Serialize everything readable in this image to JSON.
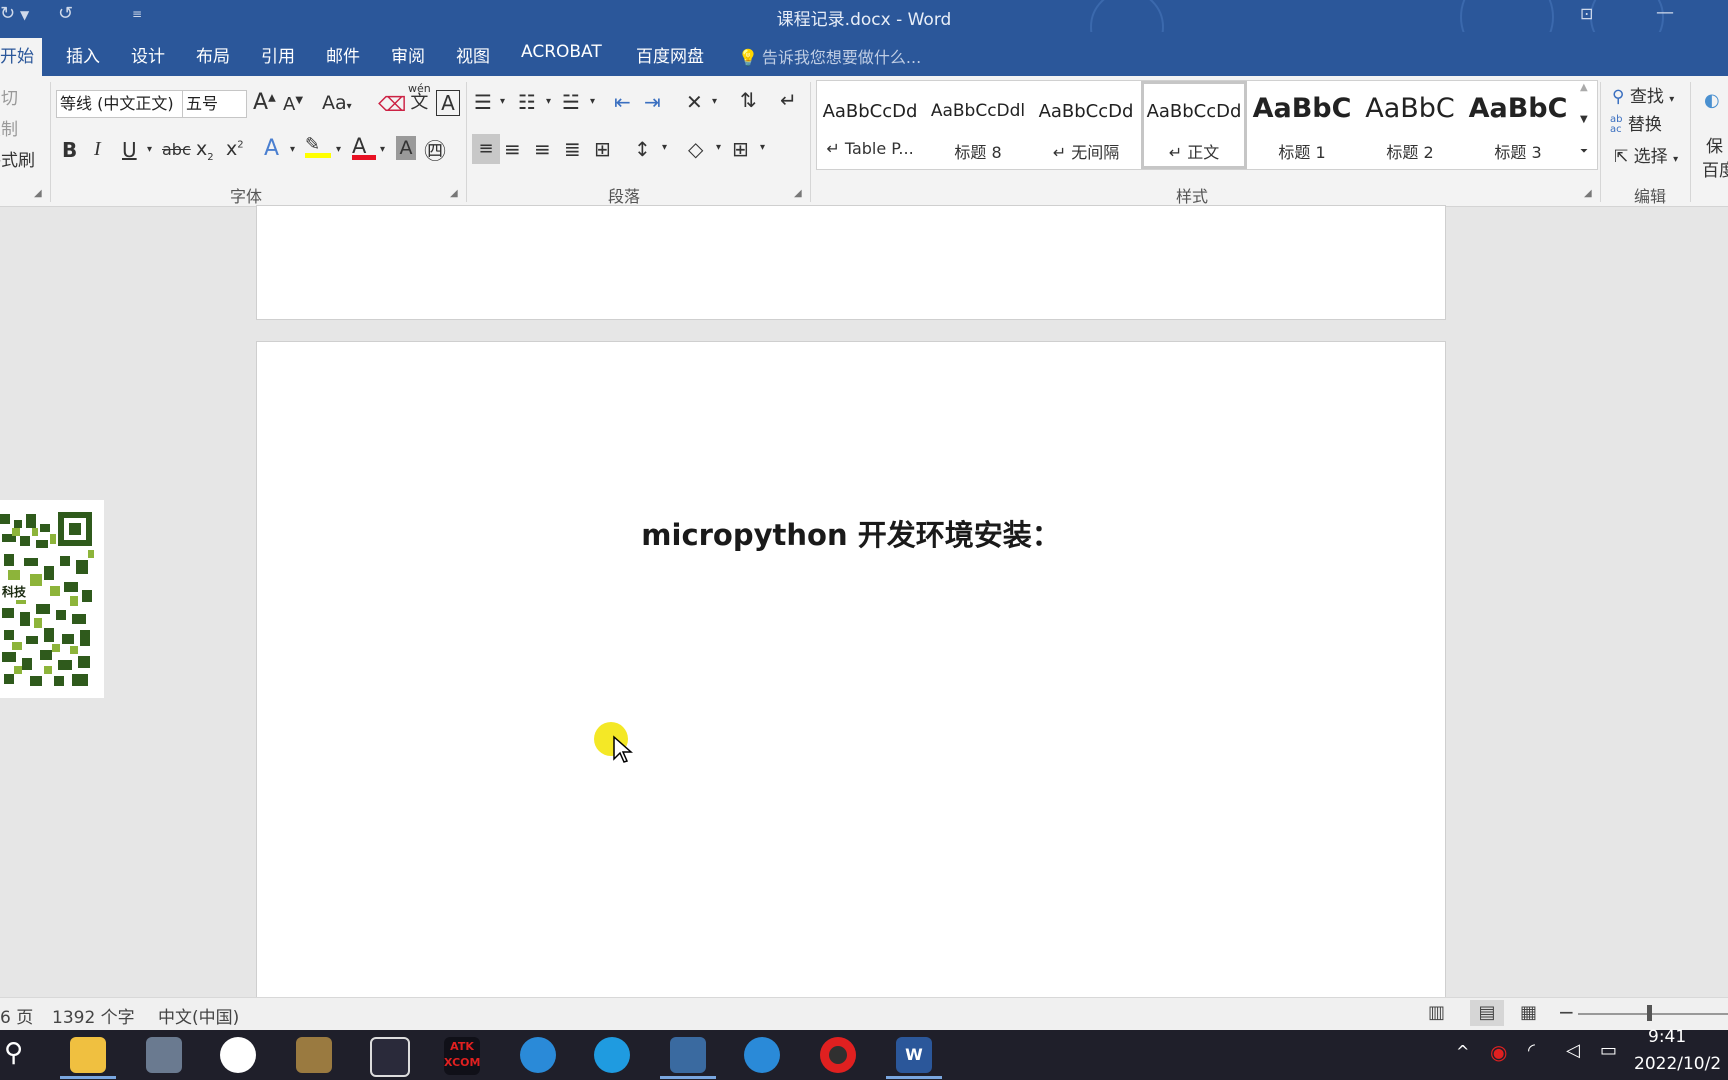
{
  "window": {
    "title": "课程记录.docx - Word"
  },
  "tabs": [
    {
      "label": "开始",
      "active": true
    },
    {
      "label": "插入"
    },
    {
      "label": "设计"
    },
    {
      "label": "布局"
    },
    {
      "label": "引用"
    },
    {
      "label": "邮件"
    },
    {
      "label": "审阅"
    },
    {
      "label": "视图"
    },
    {
      "label": "ACROBAT"
    },
    {
      "label": "百度网盘"
    }
  ],
  "tell_me": "告诉我您想要做什么...",
  "clipboard": {
    "cut": "剪切",
    "copy": "复制",
    "format_painter": "格式刷"
  },
  "font": {
    "group_label": "字体",
    "family": "等线 (中文正文)",
    "size": "五号",
    "grow": "A",
    "shrink": "A",
    "case": "Aa",
    "bold": "B",
    "italic": "I",
    "underline": "U",
    "strike": "abc",
    "subscript": "x",
    "superscript": "x",
    "phonetic_top": "wén",
    "phonetic_bottom": "文",
    "font_color": "A",
    "shading": "A"
  },
  "paragraph": {
    "group_label": "段落"
  },
  "styles": {
    "group_label": "样式",
    "items": [
      {
        "preview": "AaBbCcDd",
        "name": "Table P...",
        "mark": "↵"
      },
      {
        "preview": "AaBbCcDdl",
        "name": "标题 8"
      },
      {
        "preview": "AaBbCcDd",
        "name": "无间隔",
        "mark": "↵"
      },
      {
        "preview": "AaBbCcDd",
        "name": "正文",
        "mark": "↵",
        "selected": true
      },
      {
        "preview": "AaBbC",
        "name": "标题 1"
      },
      {
        "preview": "AaBbC",
        "name": "标题 2"
      },
      {
        "preview": "AaBbC",
        "name": "标题 3"
      }
    ]
  },
  "editing": {
    "group_label": "编辑",
    "find": "查找",
    "replace": "替换",
    "select": "选择",
    "replace_icon_top": "ab",
    "replace_icon_bottom": "ac",
    "save_partial_top": "保",
    "save_partial_bottom": "百度"
  },
  "document": {
    "heading": "micropython 开发环境安装："
  },
  "qr": {
    "caption": "科技"
  },
  "status": {
    "page": "6 页",
    "words": "1392 个字",
    "language": "中文(中国)"
  },
  "taskbar": {
    "time": "9:41",
    "date": "2022/10/2",
    "atk_top": "ATK",
    "atk_bottom": "XCOM"
  },
  "colors": {
    "word_blue": "#2b579a",
    "ribbon_bg": "#f3f3f3",
    "highlight": "#ffff00",
    "font_red": "#e81123"
  }
}
